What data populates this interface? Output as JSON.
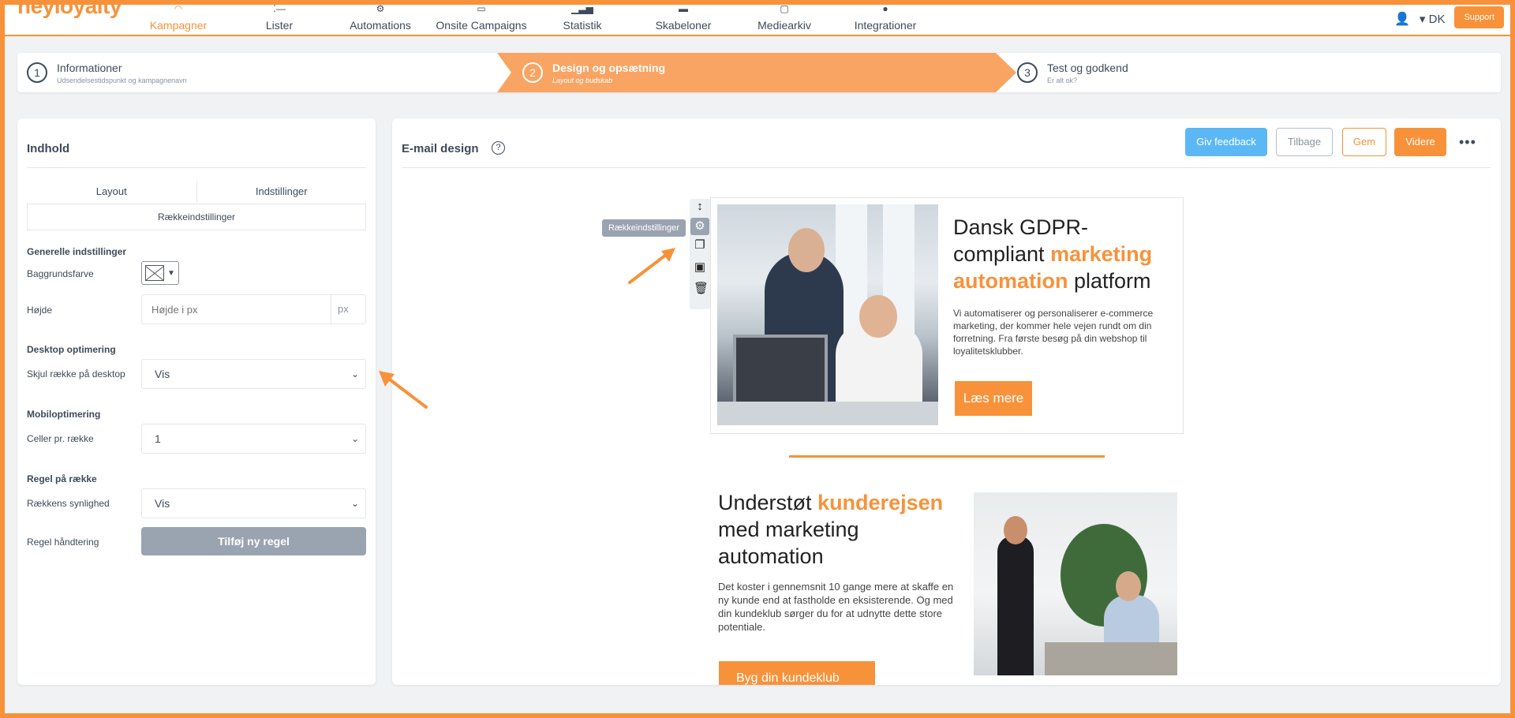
{
  "app": {
    "logo": "heyloyalty"
  },
  "nav": {
    "items": [
      {
        "label": "Kampagner",
        "icon": "megaphone-icon",
        "active": true
      },
      {
        "label": "Lister",
        "icon": "list-icon"
      },
      {
        "label": "Automations",
        "icon": "gear-icon"
      },
      {
        "label": "Onsite Campaigns",
        "icon": "window-icon"
      },
      {
        "label": "Statistik",
        "icon": "bar-chart-icon"
      },
      {
        "label": "Skabeloner",
        "icon": "template-icon"
      },
      {
        "label": "Mediearkiv",
        "icon": "image-icon"
      },
      {
        "label": "Integrationer",
        "icon": "plug-icon"
      }
    ],
    "lang": "DK",
    "support": "Support"
  },
  "stepper": {
    "steps": [
      {
        "num": "1",
        "title": "Informationer",
        "sub": "Udsendelsestidspunkt og kampagnenavn"
      },
      {
        "num": "2",
        "title": "Design og opsætning",
        "sub": "Layout og budskab",
        "active": true
      },
      {
        "num": "3",
        "title": "Test og godkend",
        "sub": "Er alt ok?"
      }
    ]
  },
  "left": {
    "title": "Indhold",
    "tabs": [
      "Layout",
      "Indstillinger"
    ],
    "subtab": "Rækkeindstillinger",
    "general": {
      "heading": "Generelle indstillinger",
      "bg_label": "Baggrundsfarve",
      "height_label": "Højde",
      "height_placeholder": "Højde i px",
      "height_unit": "px"
    },
    "desktop": {
      "heading": "Desktop optimering",
      "label": "Skjul række på desktop",
      "value": "Vis"
    },
    "mobile": {
      "heading": "Mobiloptimering",
      "label": "Celler pr. række",
      "value": "1"
    },
    "rule": {
      "heading": "Regel på række",
      "visibility_label": "Rækkens synlighed",
      "visibility_value": "Vis",
      "handling_label": "Regel håndtering",
      "add_button": "Tilføj ny regel"
    }
  },
  "right": {
    "title": "E-mail design",
    "buttons": {
      "feedback": "Giv feedback",
      "back": "Tilbage",
      "save": "Gem",
      "next": "Videre"
    },
    "tooltip": "Rækkeindstillinger",
    "block1": {
      "headline_pre": "Dansk GDPR-compliant ",
      "headline_accent": "marketing automation",
      "headline_post": " platform",
      "body": "Vi automatiserer og personaliserer e-commerce marketing, der kommer hele vejen rundt om din forretning. Fra første besøg på din webshop til loyalitetsklubber.",
      "cta": "Læs mere"
    },
    "block2": {
      "headline_pre": "Understøt ",
      "headline_accent": "kunderejsen",
      "headline_post": " med marketing automation",
      "body": "Det koster i gennemsnit 10 gange mere at skaffe en ny kunde end at fastholde en eksisterende. Og med din kundeklub sørger du for at udnytte dette store potentiale.",
      "cta": "Byg din kundeklub"
    }
  },
  "colors": {
    "accent": "#f7923a",
    "feedback": "#5bb8f5",
    "muted": "#9aa3b0"
  }
}
